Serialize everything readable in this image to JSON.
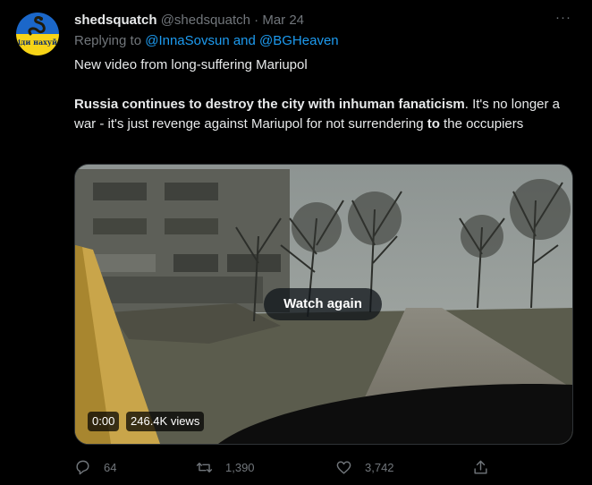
{
  "tweet": {
    "avatar_icon": "snake-flag-icon",
    "avatar_text": "іди нахуй",
    "display_name": "shedsquatch",
    "handle": "@shedsquatch",
    "separator": "·",
    "date": "Mar 24",
    "more_icon": "more-icon",
    "more_label": "···",
    "replying_prefix": "Replying to",
    "replying_to": "@InnaSovsun and @BGHeaven",
    "line1": "New video from long-suffering Mariupol",
    "line2_bold": "Russia continues to destroy the city with inhuman fanaticism",
    "line2_rest_a": ". It's no longer a war - it's just revenge against Mariupol for not surrendering ",
    "line2_bold_to": "to",
    "line2_rest_b": " the occupiers"
  },
  "video": {
    "watch_again_label": "Watch again",
    "time": "0:00",
    "views": "246.4K views"
  },
  "actions": {
    "reply_icon": "reply-icon",
    "reply_count": "64",
    "retweet_icon": "retweet-icon",
    "retweet_count": "1,390",
    "like_icon": "heart-icon",
    "like_count": "3,742",
    "share_icon": "share-icon"
  },
  "colors": {
    "background": "#000000",
    "text": "#e7e9ea",
    "muted": "#71767b",
    "link": "#1d9bf0"
  }
}
